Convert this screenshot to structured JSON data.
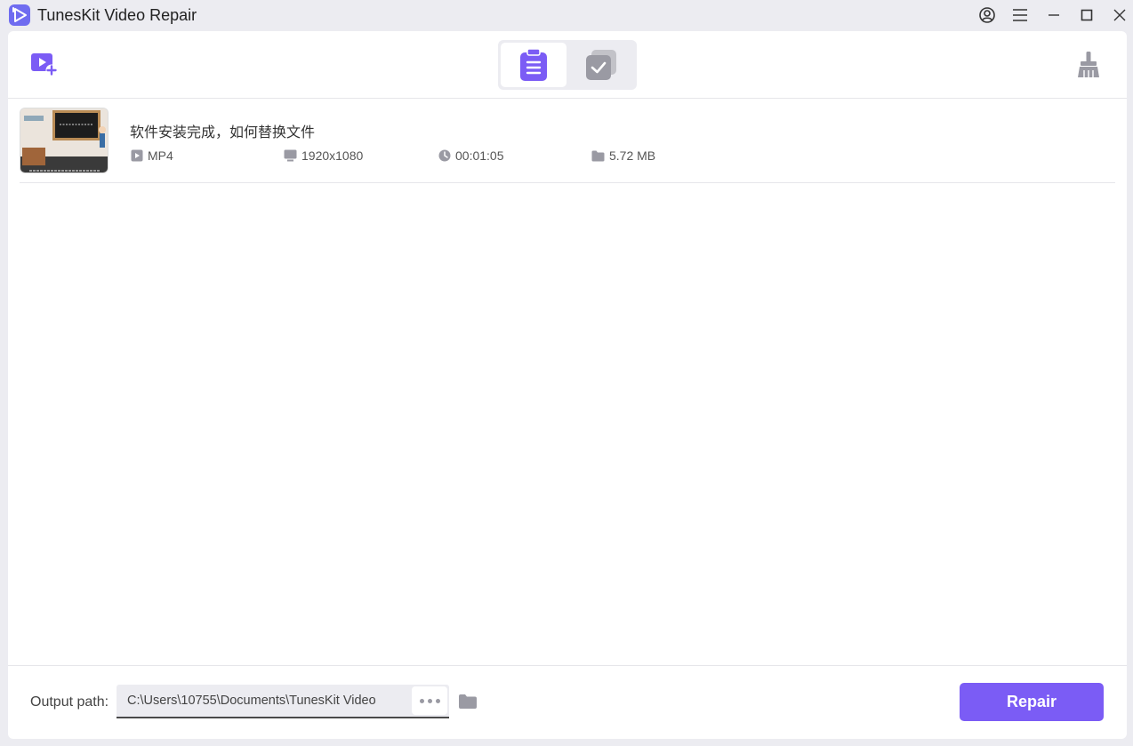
{
  "window": {
    "title": "TunesKit Video Repair"
  },
  "files": [
    {
      "name": "软件安装完成，如何替换文件",
      "format": "MP4",
      "resolution": "1920x1080",
      "duration": "00:01:05",
      "size": "5.72 MB"
    }
  ],
  "footer": {
    "output_label": "Output path:",
    "output_path": "C:\\Users\\10755\\Documents\\TunesKit Video",
    "repair_label": "Repair"
  },
  "colors": {
    "accent": "#7b5cf5",
    "icon_gray": "#9a9aa3"
  },
  "icons": {
    "add": "add-video-icon",
    "tab_list": "clipboard-list-icon",
    "tab_done": "checked-copy-icon",
    "clean": "broom-icon",
    "user": "user-account-icon",
    "menu": "hamburger-menu-icon",
    "minimize": "minimize-icon",
    "maximize": "maximize-icon",
    "close": "close-icon",
    "folder": "folder-icon"
  }
}
